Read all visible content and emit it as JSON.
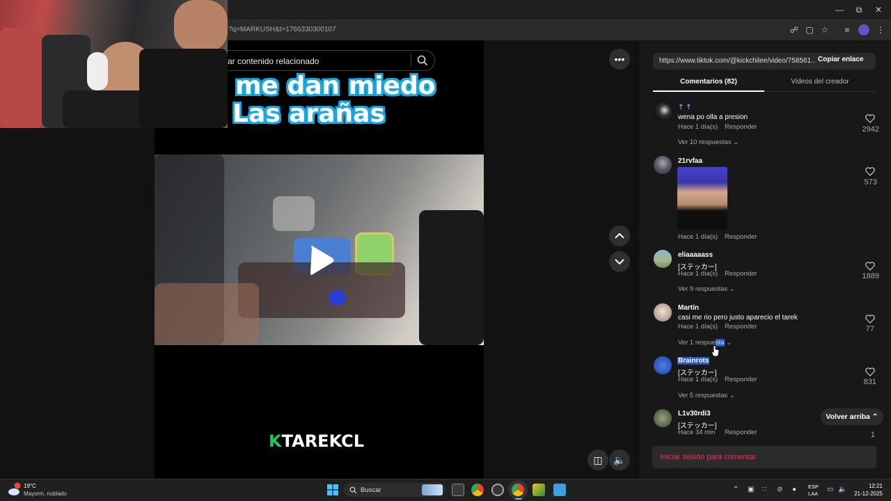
{
  "browser": {
    "url_fragment": "?q=MARKUSH&t=1766330300107",
    "window_controls": [
      "minimize",
      "restore",
      "close"
    ]
  },
  "search": {
    "placeholder": "ar contenido relacionado",
    "icon": "search-icon"
  },
  "video": {
    "title_line1": "me dan miedo",
    "title_line2": "Las arañas",
    "watermark_k": "K",
    "watermark_text": "TAREKCL",
    "play_icon": "play-icon"
  },
  "panel": {
    "share_link": "https://www.tiktok.com/@kickchilee/video/758561...",
    "copy_label": "Copiar enlace",
    "tabs": [
      {
        "label": "Comentarios (82)",
        "active": true
      },
      {
        "label": "Videos del creador",
        "active": false
      }
    ],
    "comments": [
      {
        "user": "⇡ ⇡",
        "text": "wena po olla a presion",
        "meta": "Hace 1 día(s)",
        "reply": "Responder",
        "likes": "2942",
        "more": "Ver 10 respuestas"
      },
      {
        "user": "21rvfaa",
        "text": "",
        "meta": "Hace 1 día(s)",
        "reply": "Responder",
        "likes": "573",
        "more": ""
      },
      {
        "user": "eliaaaaass",
        "text": "[ステッカー]",
        "meta": "Hace 1 día(s)",
        "reply": "Responder",
        "likes": "1889",
        "more": "Ver 9 respuestas"
      },
      {
        "user": "Martín",
        "text": "casi me rio pero justo aparecio el tarek",
        "meta": "Hace 1 día(s)",
        "reply": "Responder",
        "likes": "77",
        "more_a": "Ver 1 respue",
        "more_b": "sta"
      },
      {
        "user": "Brainrots",
        "text": "[ステッカー]",
        "meta": "Hace 1 día(s)",
        "reply": "Responder",
        "likes": "831",
        "more": "Ver 5 respuestas"
      },
      {
        "user": "L1v30rdi3",
        "text": "[ステッカー]",
        "meta": "Hace 34 min",
        "reply": "Responder",
        "likes": "1",
        "more": ""
      }
    ],
    "back_to_top": "Volver arriba",
    "login_prompt": "Iniciar sesión para comentar"
  },
  "taskbar": {
    "weather_temp": "19°C",
    "weather_desc": "Mayorm. nublado",
    "search_label": "Buscar",
    "lang_1": "ESP",
    "lang_2": "LAA",
    "time": "12:21",
    "date": "21-12-2025"
  },
  "colors": {
    "accent_red": "#fe2c55",
    "title_outline": "#1aa7e0",
    "brand_green": "#22c55e",
    "selection": "#2955c9"
  }
}
